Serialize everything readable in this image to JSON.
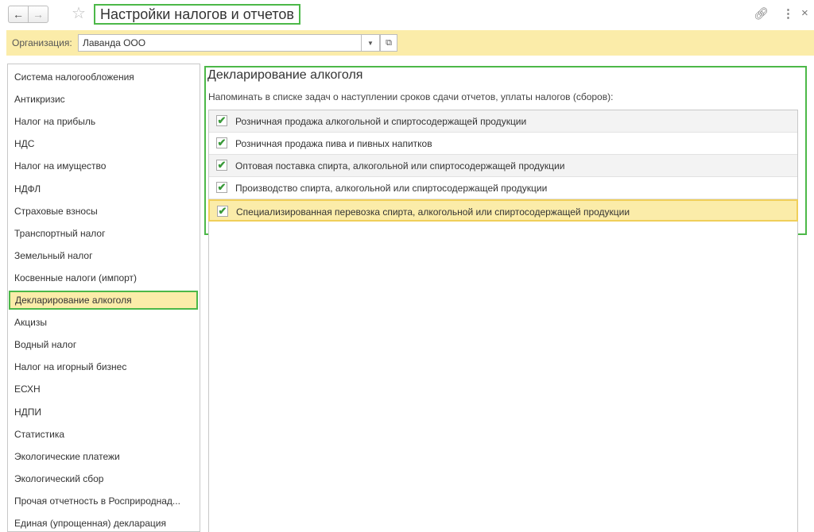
{
  "window": {
    "title": "Настройки налогов и отчетов"
  },
  "icons": {
    "back": "arrow-left-icon",
    "forward": "arrow-right-icon",
    "star": "star-icon",
    "link": "link-icon",
    "more": "more-icon",
    "close": "close-icon"
  },
  "org": {
    "label": "Организация:",
    "value": "Лаванда ООО"
  },
  "sidebar": {
    "items": [
      {
        "label": "Система налогообложения"
      },
      {
        "label": "Антикризис"
      },
      {
        "label": "Налог на прибыль"
      },
      {
        "label": "НДС"
      },
      {
        "label": "Налог на имущество"
      },
      {
        "label": "НДФЛ"
      },
      {
        "label": "Страховые взносы"
      },
      {
        "label": "Транспортный налог"
      },
      {
        "label": "Земельный налог"
      },
      {
        "label": "Косвенные налоги (импорт)"
      },
      {
        "label": "Декларирование алкоголя"
      },
      {
        "label": "Акцизы"
      },
      {
        "label": "Водный налог"
      },
      {
        "label": "Налог на игорный бизнес"
      },
      {
        "label": "ЕСХН"
      },
      {
        "label": "НДПИ"
      },
      {
        "label": "Статистика"
      },
      {
        "label": "Экологические платежи"
      },
      {
        "label": "Экологический сбор"
      },
      {
        "label": "Прочая отчетность в Росприроднад..."
      },
      {
        "label": "Единая (упрощенная) декларация"
      }
    ],
    "active_index": 10
  },
  "main": {
    "title": "Декларирование алкоголя",
    "hint": "Напоминать в списке задач о наступлении сроков сдачи отчетов, уплаты налогов (сборов):",
    "rows": [
      {
        "label": "Розничная продажа алкогольной и спиртосодержащей продукции",
        "checked": true
      },
      {
        "label": "Розничная продажа пива и пивных напитков",
        "checked": true
      },
      {
        "label": "Оптовая поставка спирта, алкогольной или спиртосодержащей продукции",
        "checked": true
      },
      {
        "label": "Производство спирта, алкогольной или спиртосодержащей продукции",
        "checked": true
      },
      {
        "label": "Специализированная перевозка спирта, алкогольной или спиртосодержащей продукции",
        "checked": true
      }
    ],
    "selected_row": 4
  },
  "colors": {
    "accent_green": "#4cb848",
    "highlight_yellow": "#fbeca9",
    "check_green": "#3a9a3a"
  }
}
